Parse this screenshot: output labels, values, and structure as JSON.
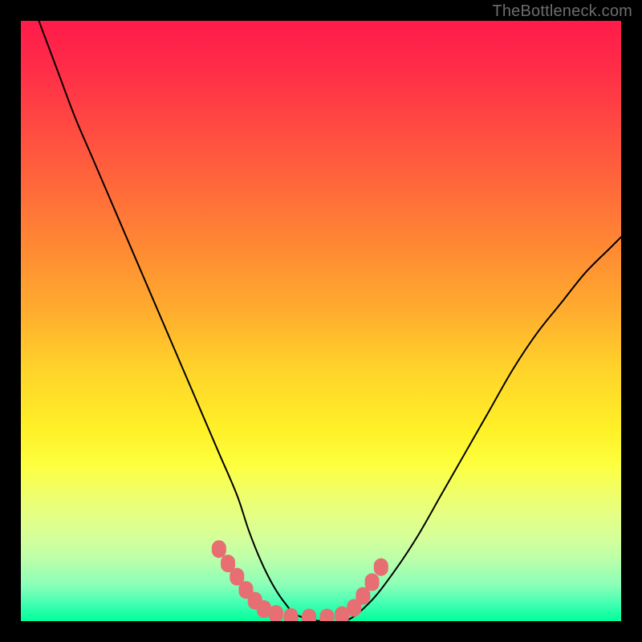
{
  "watermark": {
    "text": "TheBottleneck.com"
  },
  "chart_data": {
    "type": "line",
    "title": "",
    "xlabel": "",
    "ylabel": "",
    "xlim": [
      0,
      100
    ],
    "ylim": [
      0,
      100
    ],
    "series": [
      {
        "name": "curve",
        "x": [
          3,
          6,
          9,
          12,
          15,
          18,
          21,
          24,
          27,
          30,
          33,
          36,
          38,
          40,
          42,
          44,
          46,
          50,
          54,
          58,
          62,
          66,
          70,
          74,
          78,
          82,
          86,
          90,
          94,
          98,
          100
        ],
        "y": [
          100,
          92,
          84,
          77,
          70,
          63,
          56,
          49,
          42,
          35,
          28,
          21,
          15,
          10,
          6,
          3,
          1,
          0,
          0,
          3,
          8,
          14,
          21,
          28,
          35,
          42,
          48,
          53,
          58,
          62,
          64
        ]
      }
    ],
    "markers": [
      {
        "name": "pink-dots-left",
        "shape": "rounded",
        "color": "#e76e72",
        "points": [
          {
            "x": 33.0,
            "y": 12.0
          },
          {
            "x": 34.5,
            "y": 9.6
          },
          {
            "x": 36.0,
            "y": 7.4
          },
          {
            "x": 37.5,
            "y": 5.2
          },
          {
            "x": 39.0,
            "y": 3.4
          },
          {
            "x": 40.5,
            "y": 2.0
          },
          {
            "x": 42.5,
            "y": 1.2
          }
        ]
      },
      {
        "name": "pink-dots-bottom",
        "shape": "rounded",
        "color": "#e76e72",
        "points": [
          {
            "x": 45.0,
            "y": 0.7
          },
          {
            "x": 48.0,
            "y": 0.6
          },
          {
            "x": 51.0,
            "y": 0.6
          }
        ]
      },
      {
        "name": "pink-dots-right",
        "shape": "rounded",
        "color": "#e76e72",
        "points": [
          {
            "x": 53.5,
            "y": 1.0
          },
          {
            "x": 55.5,
            "y": 2.2
          },
          {
            "x": 57.0,
            "y": 4.2
          },
          {
            "x": 58.5,
            "y": 6.5
          },
          {
            "x": 60.0,
            "y": 9.0
          }
        ]
      }
    ]
  }
}
